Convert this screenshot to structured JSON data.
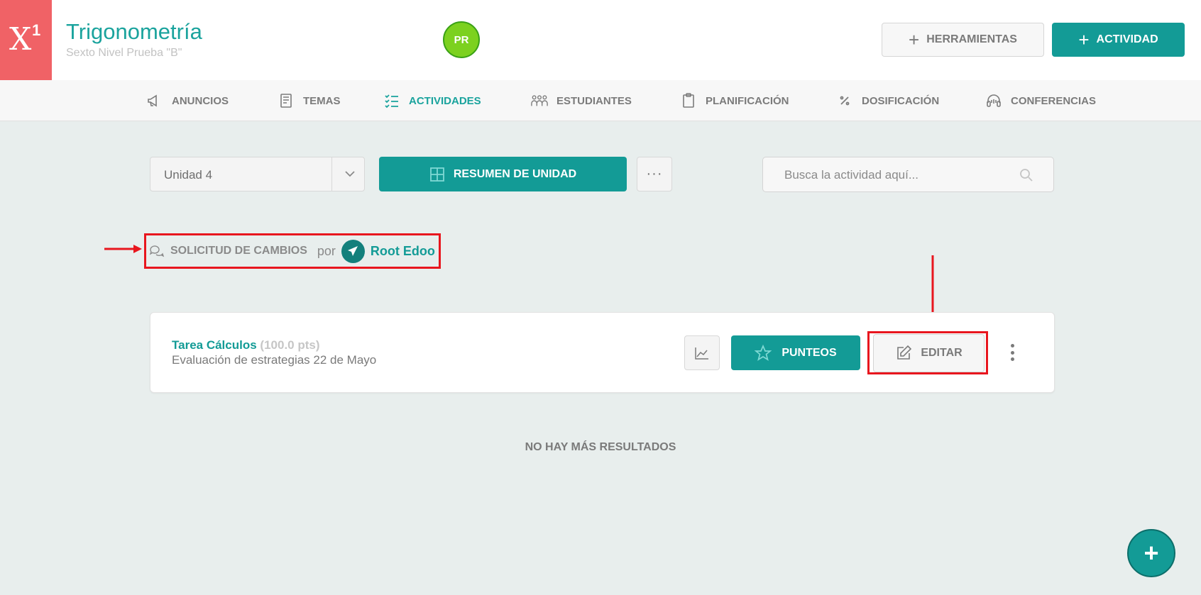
{
  "header": {
    "logo_text": "X",
    "logo_superscript": "1",
    "course_title": "Trigonometría",
    "course_subtitle": "Sexto Nivel Prueba \"B\"",
    "avatar_initials": "PR",
    "tools_label": "HERRAMIENTAS",
    "activity_label": "ACTIVIDAD"
  },
  "nav": {
    "items": [
      {
        "label": "ANUNCIOS",
        "icon": "megaphone-icon"
      },
      {
        "label": "TEMAS",
        "icon": "book-icon"
      },
      {
        "label": "ACTIVIDADES",
        "icon": "checklist-icon",
        "active": true
      },
      {
        "label": "ESTUDIANTES",
        "icon": "students-icon"
      },
      {
        "label": "PLANIFICACIÓN",
        "icon": "clipboard-icon"
      },
      {
        "label": "DOSIFICACIÓN",
        "icon": "percent-icon"
      },
      {
        "label": "CONFERENCIAS",
        "icon": "headset-icon"
      }
    ]
  },
  "toolbar": {
    "unit_value": "Unidad 4",
    "summary_label": "RESUMEN DE UNIDAD",
    "more_label": "···",
    "search_placeholder": "Busca la actividad aquí..."
  },
  "change_request": {
    "label": "SOLICITUD DE CAMBIOS",
    "connector": "por",
    "author": "Root Edoo"
  },
  "activity": {
    "name": "Tarea Cálculos",
    "points": "(100.0 pts)",
    "description": "Evaluación de estrategias 22 de Mayo",
    "scores_label": "PUNTEOS",
    "edit_label": "EDITAR"
  },
  "footer": {
    "no_more_results": "NO HAY MÁS RESULTADOS",
    "fab_label": "+"
  },
  "colors": {
    "accent": "#139b96",
    "logo_bg": "#f06266",
    "avatar_bg": "#7cd11f",
    "annotation": "#e8161e",
    "page_bg": "#e8eeed"
  }
}
